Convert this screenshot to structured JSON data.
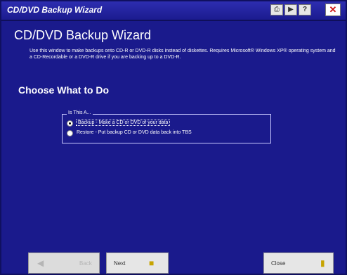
{
  "window": {
    "title": "CD/DVD Backup Wizard"
  },
  "header": {
    "heading": "CD/DVD Backup Wizard",
    "description": "Use this window to make backups onto CD-R or DVD-R disks instead of diskettes. Requires Microsoft® Windows XP® operating system and a CD-Recordable or a DVD-R drive if you are backing up to a DVD-R."
  },
  "section": {
    "title": "Choose What to Do"
  },
  "group": {
    "legend": "Is This A...",
    "options": [
      {
        "label": "Backup - Make a CD or DVD of your data",
        "selected": true
      },
      {
        "label": "Restore - Put backup CD or DVD data back into TBS",
        "selected": false
      }
    ]
  },
  "footer": {
    "back_label": "Back",
    "next_label": "Next",
    "close_label": "Close"
  },
  "icons": {
    "titlebar": [
      "printer-icon",
      "help-book-icon",
      "question-icon",
      "close-icon"
    ],
    "back": "back-arrow-icon",
    "next": "next-folder-icon",
    "close": "door-icon"
  }
}
